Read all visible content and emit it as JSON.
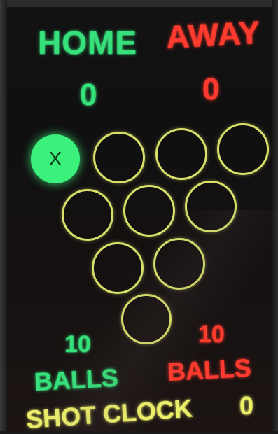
{
  "scoreboard": {
    "home": {
      "label": "HOME",
      "score": "0",
      "balls_count": "10",
      "balls_label": "BALLS",
      "color": "#36e07a"
    },
    "away": {
      "label": "AWAY",
      "score": "0",
      "balls_count": "10",
      "balls_label": "BALLS",
      "color": "#ff3b2f"
    },
    "shot_clock": {
      "label": "SHOT CLOCK",
      "value": "0",
      "color": "#ecef6a"
    },
    "rack": {
      "pocketed_mark": "X",
      "rows": [
        [
          {
            "state": "pocketed"
          },
          {
            "state": "standing"
          },
          {
            "state": "standing"
          },
          {
            "state": "standing"
          }
        ],
        [
          {
            "state": "standing"
          },
          {
            "state": "standing"
          },
          {
            "state": "standing"
          }
        ],
        [
          {
            "state": "standing"
          },
          {
            "state": "standing"
          }
        ],
        [
          {
            "state": "standing"
          }
        ]
      ]
    }
  }
}
